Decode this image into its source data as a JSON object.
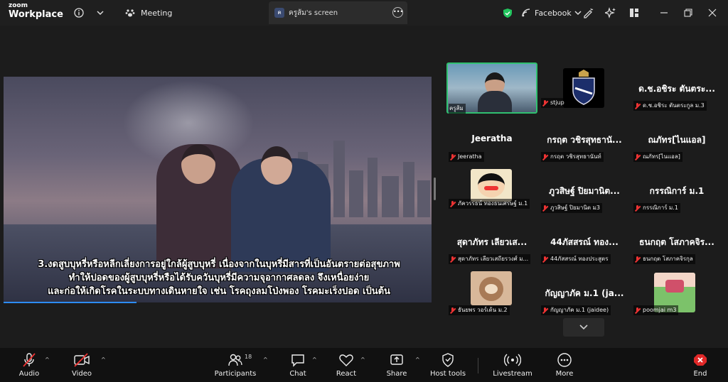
{
  "app": {
    "logo_top": "zoom",
    "logo_bottom": "Workplace"
  },
  "topbar": {
    "meeting_label": "Meeting",
    "share_tab": {
      "avatar": "ค",
      "title": "ครูส้ม's screen"
    },
    "facebook_label": "Facebook"
  },
  "content": {
    "caption_line1": "3.งดสูบบุหรี่หรือหลีกเลี่ยงการอยู่ใกล้ผู้สูบบุหรี่ เนื่องจากในบุหรี่มีสารที่เป็นอันตรายต่อสุขภาพ",
    "caption_line2": "ทำให้ปอดของผู้สูบบุหรี่หรือได้รับควันบุหรี่มีความจุอากาศลดลง จึงเหนื่อยง่าย",
    "caption_line3": "และก่อให้เกิดโรคในระบบทางเดินหายใจ เช่น โรคถุงลมโป่งพอง โรคมะเร็งปอด เป็นต้น"
  },
  "participants": [
    {
      "big": "",
      "name": "ครูส้ม",
      "video": true
    },
    {
      "big": "",
      "name": "stjup",
      "video": true
    },
    {
      "big": "ด.ช.อชิระ ตันตระ...",
      "name": "ด.ช.อชิระ ตันตระกูล ม.3"
    },
    {
      "big": "Jeeratha",
      "name": "Jeeratha"
    },
    {
      "big": "กรฤต วชิรสุทธานั...",
      "name": "กรฤต วชิรสุทธานันท์"
    },
    {
      "big": "ณภัทร[ไนแอล]",
      "name": "ณภัทร[ไนแอล]"
    },
    {
      "big": "",
      "name": "ภัควรรธน์ ทองธนเศรษฐ์ ม.1"
    },
    {
      "big": "ภูวสิษฐ์ ปิยมานิต...",
      "name": "ภูวสิษฐ์ ปิยมานิต ม3"
    },
    {
      "big": "กรรณิการ์ ม.1",
      "name": "กรรณิการ์ ม.1"
    },
    {
      "big": "สุดาภัทร เลียวเส...",
      "name": "สุดาภัทร เลียวเสถียรวงศ์ ม..."
    },
    {
      "big": "44ภัสสรณ์ ทอง...",
      "name": "44ภัสสรณ์ ทองประสูตร"
    },
    {
      "big": "ธนกฤต โสภาคจิร...",
      "name": "ธนกฤต โสภาคจิรกุล"
    },
    {
      "big": "",
      "name": "ธันยพร วอร์เด้น ม.2"
    },
    {
      "big": "กัญญาภัค ม.1 (ja...",
      "name": "กัญญาภัค ม.1 (jaidee)"
    },
    {
      "big": "",
      "name": "poomjai m3"
    }
  ],
  "toolbar": {
    "audio": "Audio",
    "video": "Video",
    "participants": "Participants",
    "participants_count": "18",
    "chat": "Chat",
    "react": "React",
    "share": "Share",
    "host_tools": "Host tools",
    "livestream": "Livestream",
    "more": "More",
    "end": "End"
  },
  "colors": {
    "accent": "#2d8cff",
    "active_speaker": "#30c070",
    "muted": "#e33333",
    "shield": "#22c55e",
    "end": "#e02828"
  }
}
